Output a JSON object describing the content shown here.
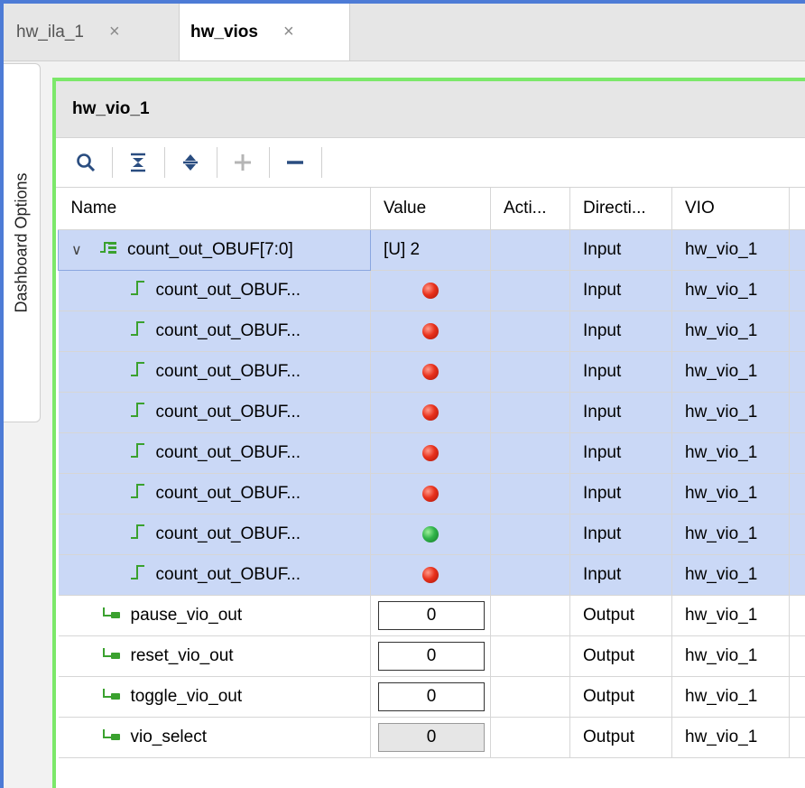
{
  "tabs": [
    {
      "label": "hw_ila_1",
      "close": "×"
    },
    {
      "label": "hw_vios",
      "close": "×"
    }
  ],
  "side_tab": {
    "label": "Dashboard Options"
  },
  "panel": {
    "title": "hw_vio_1"
  },
  "toolbar": {
    "icons": [
      "search-icon",
      "collapse-all-icon",
      "expand-all-icon",
      "add-icon",
      "remove-icon"
    ]
  },
  "columns": [
    "Name",
    "Value",
    "Acti...",
    "Directi...",
    "VIO"
  ],
  "rows": [
    {
      "name": "count_out_OBUF[7:0]",
      "value": "[U] 2",
      "activity": "",
      "direction": "Input",
      "vio": "hw_vio_1",
      "kind": "bus"
    },
    {
      "name": "count_out_OBUF...",
      "led": "red",
      "activity": "",
      "direction": "Input",
      "vio": "hw_vio_1",
      "kind": "bit"
    },
    {
      "name": "count_out_OBUF...",
      "led": "red",
      "activity": "",
      "direction": "Input",
      "vio": "hw_vio_1",
      "kind": "bit"
    },
    {
      "name": "count_out_OBUF...",
      "led": "red",
      "activity": "",
      "direction": "Input",
      "vio": "hw_vio_1",
      "kind": "bit"
    },
    {
      "name": "count_out_OBUF...",
      "led": "red",
      "activity": "",
      "direction": "Input",
      "vio": "hw_vio_1",
      "kind": "bit"
    },
    {
      "name": "count_out_OBUF...",
      "led": "red",
      "activity": "",
      "direction": "Input",
      "vio": "hw_vio_1",
      "kind": "bit"
    },
    {
      "name": "count_out_OBUF...",
      "led": "red",
      "activity": "",
      "direction": "Input",
      "vio": "hw_vio_1",
      "kind": "bit"
    },
    {
      "name": "count_out_OBUF...",
      "led": "green",
      "activity": "",
      "direction": "Input",
      "vio": "hw_vio_1",
      "kind": "bit"
    },
    {
      "name": "count_out_OBUF...",
      "led": "red",
      "activity": "",
      "direction": "Input",
      "vio": "hw_vio_1",
      "kind": "bit"
    },
    {
      "name": "pause_vio_out",
      "value": "0",
      "activity": "",
      "direction": "Output",
      "vio": "hw_vio_1",
      "kind": "out"
    },
    {
      "name": "reset_vio_out",
      "value": "0",
      "activity": "",
      "direction": "Output",
      "vio": "hw_vio_1",
      "kind": "out"
    },
    {
      "name": "toggle_vio_out",
      "value": "0",
      "activity": "",
      "direction": "Output",
      "vio": "hw_vio_1",
      "kind": "out"
    },
    {
      "name": "vio_select",
      "value": "0",
      "activity": "",
      "direction": "Output",
      "vio": "hw_vio_1",
      "kind": "out-disabled"
    }
  ],
  "colors": {
    "selection": "#cad8f6",
    "panel_border": "#7ce86a",
    "led_red": "#e8311c",
    "led_green": "#2fb34a",
    "signal_icon": "#3aa12e"
  }
}
